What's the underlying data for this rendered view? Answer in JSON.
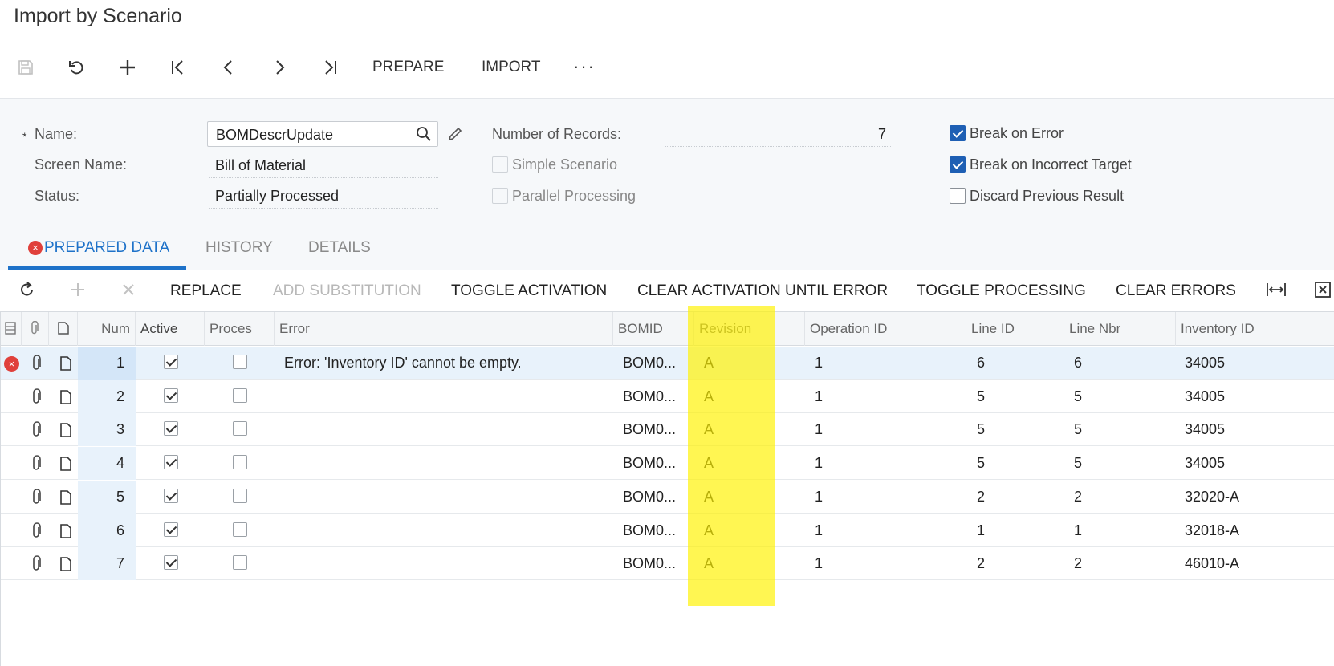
{
  "page": {
    "title": "Import by Scenario"
  },
  "toolbar": {
    "icons": [
      "save-icon",
      "undo-icon",
      "add-icon",
      "first-record-icon",
      "previous-record-icon",
      "next-record-icon",
      "last-record-icon"
    ],
    "prepare_label": "PREPARE",
    "import_label": "IMPORT",
    "more_label": "···"
  },
  "form": {
    "name_required_mark": "*",
    "name_label": "Name:",
    "name_value": "BOMDescrUpdate",
    "screen_name_label": "Screen Name:",
    "screen_name_value": "Bill of Material",
    "status_label": "Status:",
    "status_value": "Partially Processed",
    "records_label": "Number of Records:",
    "records_value": "7",
    "simple_scenario_label": "Simple Scenario",
    "parallel_processing_label": "Parallel Processing",
    "break_on_error_label": "Break on Error",
    "break_on_incorrect_target_label": "Break on Incorrect Target",
    "discard_previous_result_label": "Discard Previous Result",
    "checkboxes": {
      "simple_scenario": false,
      "parallel_processing": false,
      "break_on_error": true,
      "break_on_incorrect_target": true,
      "discard_previous_result": false
    }
  },
  "tabs": {
    "prepared_data": "PREPARED DATA",
    "history": "HISTORY",
    "details": "DETAILS",
    "error_mark": "×"
  },
  "grid_toolbar": {
    "replace": "REPLACE",
    "add_substitution": "ADD SUBSTITUTION",
    "toggle_activation": "TOGGLE ACTIVATION",
    "clear_activation_until_error": "CLEAR ACTIVATION UNTIL ERROR",
    "toggle_processing": "TOGGLE PROCESSING",
    "clear_errors": "CLEAR ERRORS"
  },
  "grid": {
    "headers": {
      "num": "Num",
      "active": "Active",
      "processed": "Proces",
      "error": "Error",
      "bomid": "BOMID",
      "revision": "Revision",
      "operation_id": "Operation ID",
      "line_id": "Line ID",
      "line_nbr": "Line Nbr",
      "inventory_id": "Inventory ID"
    },
    "rows": [
      {
        "num": "1",
        "active": true,
        "processed": false,
        "error": "Error: 'Inventory ID' cannot be empty.",
        "bomid": "BOM0...",
        "revision": "A",
        "operation_id": "1",
        "line_id": "6",
        "line_nbr": "6",
        "inventory_id": "34005"
      },
      {
        "num": "2",
        "active": true,
        "processed": false,
        "error": "",
        "bomid": "BOM0...",
        "revision": "A",
        "operation_id": "1",
        "line_id": "5",
        "line_nbr": "5",
        "inventory_id": "34005"
      },
      {
        "num": "3",
        "active": true,
        "processed": false,
        "error": "",
        "bomid": "BOM0...",
        "revision": "A",
        "operation_id": "1",
        "line_id": "5",
        "line_nbr": "5",
        "inventory_id": "34005"
      },
      {
        "num": "4",
        "active": true,
        "processed": false,
        "error": "",
        "bomid": "BOM0...",
        "revision": "A",
        "operation_id": "1",
        "line_id": "5",
        "line_nbr": "5",
        "inventory_id": "34005"
      },
      {
        "num": "5",
        "active": true,
        "processed": false,
        "error": "",
        "bomid": "BOM0...",
        "revision": "A",
        "operation_id": "1",
        "line_id": "2",
        "line_nbr": "2",
        "inventory_id": "32020-A"
      },
      {
        "num": "6",
        "active": true,
        "processed": false,
        "error": "",
        "bomid": "BOM0...",
        "revision": "A",
        "operation_id": "1",
        "line_id": "1",
        "line_nbr": "1",
        "inventory_id": "32018-A"
      },
      {
        "num": "7",
        "active": true,
        "processed": false,
        "error": "",
        "bomid": "BOM0...",
        "revision": "A",
        "operation_id": "1",
        "line_id": "2",
        "line_nbr": "2",
        "inventory_id": "46010-A"
      }
    ],
    "error_row_mark": "×"
  },
  "colors": {
    "accent": "#1e72c9",
    "checkbox_checked": "#1e5fb4",
    "error": "#e0403b",
    "highlight": "#fff100"
  }
}
